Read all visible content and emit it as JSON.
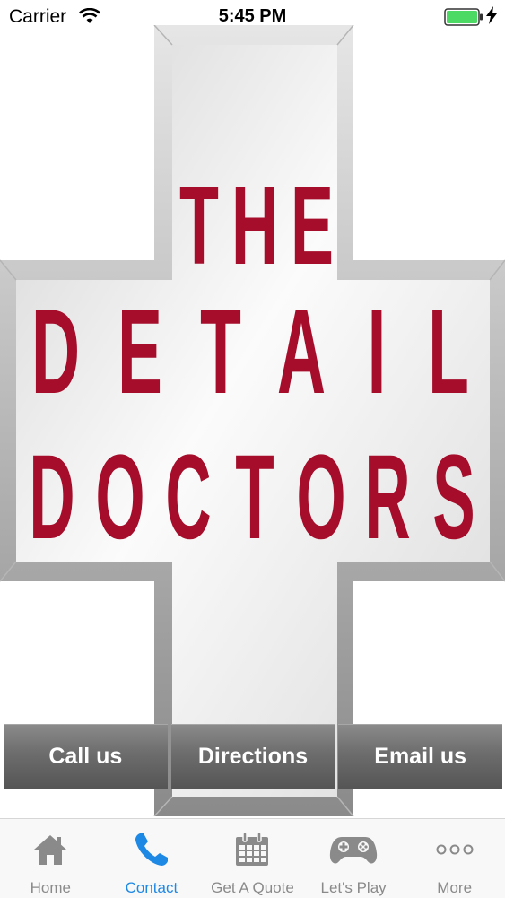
{
  "status_bar": {
    "carrier": "Carrier",
    "time": "5:45 PM"
  },
  "logo": {
    "line1": [
      "T",
      "H",
      "E"
    ],
    "line2": [
      "D",
      "E",
      "T",
      "A",
      "I",
      "L"
    ],
    "line3": [
      "D",
      "O",
      "C",
      "T",
      "O",
      "R",
      "S"
    ],
    "letter_color": "#a50d2b"
  },
  "actions": {
    "call_label": "Call us",
    "directions_label": "Directions",
    "email_label": "Email us"
  },
  "tabs": [
    {
      "label": "Home",
      "icon": "home-icon"
    },
    {
      "label": "Contact",
      "icon": "phone-icon",
      "active": true
    },
    {
      "label": "Get A Quote",
      "icon": "calendar-icon"
    },
    {
      "label": "Let's Play",
      "icon": "gamepad-icon"
    },
    {
      "label": "More",
      "icon": "more-icon"
    }
  ],
  "colors": {
    "accent": "#1e88e5",
    "inactive_tab": "#8a8a8a",
    "battery": "#4cd964"
  }
}
